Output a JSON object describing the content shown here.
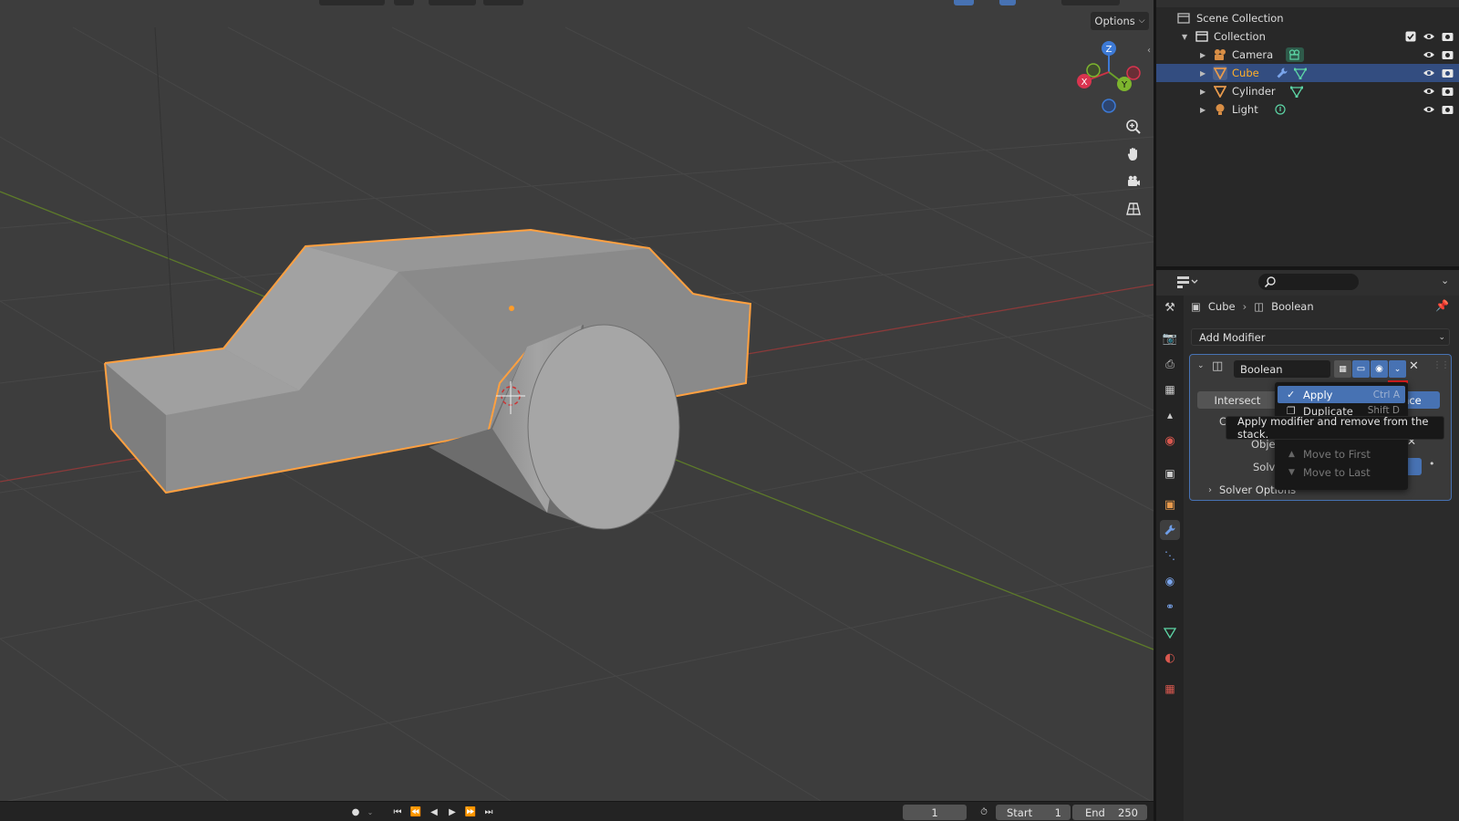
{
  "viewport": {
    "options_label": "Options",
    "gizmo": {
      "z": "Z",
      "y": "Y",
      "x": "X"
    }
  },
  "timeline": {
    "current_frame": "1",
    "start_label": "Start",
    "start_value": "1",
    "end_label": "End",
    "end_value": "250"
  },
  "outliner": {
    "scene_collection": "Scene Collection",
    "collection": "Collection",
    "items": [
      {
        "label": "Camera",
        "icon": "camera-object-icon",
        "data_icon": "camera-data-icon",
        "selected": false
      },
      {
        "label": "Cube",
        "icon": "mesh-object-icon",
        "data_icon": "mesh-data-icon",
        "selected": true
      },
      {
        "label": "Cylinder",
        "icon": "mesh-object-icon",
        "data_icon": "mesh-data-icon",
        "selected": false
      },
      {
        "label": "Light",
        "icon": "light-object-icon",
        "data_icon": "light-data-icon",
        "selected": false
      }
    ]
  },
  "properties": {
    "breadcrumb": {
      "object": "Cube",
      "modifier": "Boolean"
    },
    "add_modifier": "Add Modifier",
    "modifier": {
      "name": "Boolean",
      "operations": {
        "intersect": "Intersect",
        "difference_partial": "ence"
      },
      "row_operand_partial": "C",
      "row_object_partial": "Obje",
      "row_solver_partial": "Solv",
      "solver_options": "Solver Options"
    }
  },
  "dropdown": {
    "items": [
      {
        "label": "Apply",
        "shortcut": "Ctrl A"
      },
      {
        "label": "Duplicate",
        "shortcut": "Shift D"
      },
      {
        "label": "Move to First",
        "shortcut": ""
      },
      {
        "label": "Move to Last",
        "shortcut": ""
      }
    ]
  },
  "tooltip": "Apply modifier and remove from the stack.",
  "colors": {
    "accent": "#4772b3",
    "selection_outline": "#ffa040",
    "selected_text": "#ffaf29",
    "highlight_marker": "#e62020"
  }
}
